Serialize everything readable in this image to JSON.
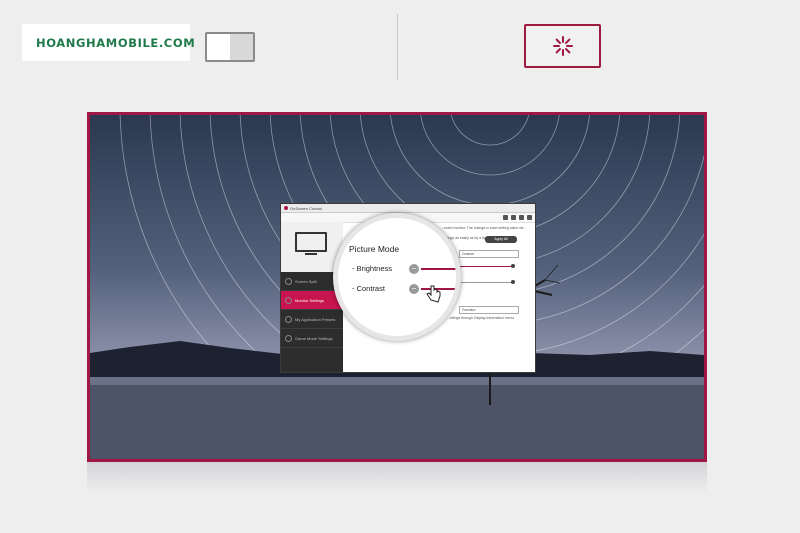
{
  "header": {
    "logo_text": "HOANGHAMOBILE.COM",
    "brand_color": "#1f7a4a",
    "toggle_icon": "toggle-icon",
    "settings_icon": "loading-spinner-icon",
    "accent_color": "#9c1b3f"
  },
  "screen": {
    "window_title": "OnScreen Control",
    "apply_label": "Apply All",
    "description_text": "...ected monitor. The change in each setting value wil...",
    "description_text2": "...ettings as easily as by a light screen.",
    "select_picture_mode": "Custom",
    "select_function": "Function",
    "description_text3": "...ettings through Display Information menu.",
    "sidebar_items": [
      {
        "label": "Screen Split",
        "active": false
      },
      {
        "label": "Monitor Settings",
        "active": true
      },
      {
        "label": "My Application Presets",
        "active": false
      },
      {
        "label": "Game Mode Settings",
        "active": false
      }
    ],
    "zoom": {
      "title": "Picture Mode",
      "brightness_label": "- Brightness",
      "contrast_label": "- Contrast",
      "minus_symbol": "−"
    }
  }
}
